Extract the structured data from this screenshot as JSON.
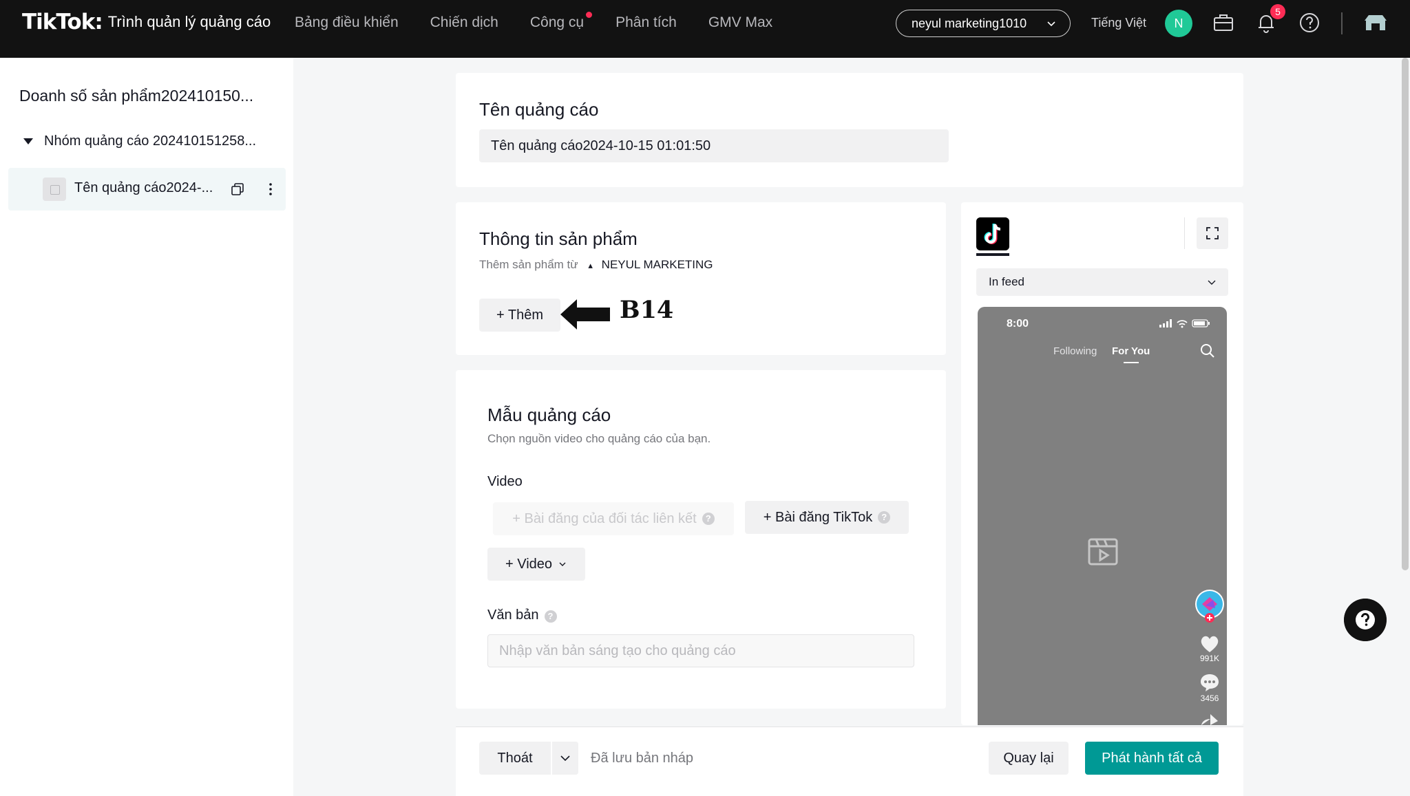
{
  "header": {
    "logo": "TikTok",
    "logo_dot": ":",
    "product": "Trình quản lý quảng cáo",
    "nav": [
      "Bảng điều khiển",
      "Chiến dịch",
      "Công cụ",
      "Phân tích",
      "GMV Max"
    ],
    "account": "neyul marketing1010",
    "language": "Tiếng Việt",
    "avatar_initial": "N",
    "notification_count": "5"
  },
  "sidebar": {
    "campaign": "Doanh số sản phẩm202410150...",
    "ad_group": "Nhóm quảng cáo 202410151258...",
    "ad": "Tên quảng cáo2024-..."
  },
  "ad_name": {
    "title": "Tên quảng cáo",
    "value": "Tên quảng cáo2024-10-15 01:01:50"
  },
  "product_info": {
    "title": "Thông tin sản phẩm",
    "source_prefix": "Thêm sản phẩm từ",
    "source_shop": "NEYUL MARKETING",
    "add_label": "+ Thêm"
  },
  "annotation": {
    "label": "B14"
  },
  "creative": {
    "title": "Mẫu quảng cáo",
    "subtitle": "Chọn nguồn video cho quảng cáo của bạn.",
    "video_label": "Video",
    "affiliate_post": "+ Bài đăng của đối tác liên kết",
    "tiktok_post": "+ Bài đăng TikTok",
    "video_button": "+ Video",
    "text_label": "Văn bản",
    "text_placeholder": "Nhập văn bản sáng tạo cho quảng cáo"
  },
  "preview": {
    "placement": "In feed",
    "time": "8:00",
    "tab_following": "Following",
    "tab_for_you": "For You",
    "likes": "991K",
    "comments": "3456"
  },
  "footer": {
    "exit": "Thoát",
    "saved": "Đã lưu bản nháp",
    "back": "Quay lại",
    "publish": "Phát hành tất cả"
  },
  "colors": {
    "primary": "#009995",
    "accent": "#fe2c55",
    "topbar": "#121212",
    "avatar": "#20c997"
  }
}
